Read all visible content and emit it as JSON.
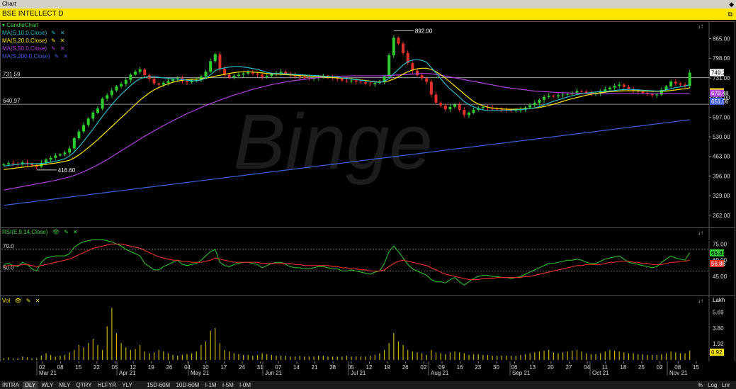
{
  "window": {
    "title": "Chart",
    "symbol": "BSE INTELLECT D"
  },
  "legend": {
    "main": "CandleChart",
    "ma": [
      {
        "label": "MA(S,10.0,Close)",
        "color": "#2bb8c8"
      },
      {
        "label": "MA(S,20.0,Close)",
        "color": "#ffe800"
      },
      {
        "label": "MA(S,50.0,Close)",
        "color": "#b040e0"
      },
      {
        "label": "MA(S,200.0,Close)",
        "color": "#4060e0"
      }
    ],
    "rsi": "RSI(E,9,14,Close)",
    "vol": "Vol",
    "vol_unit": "Lakh"
  },
  "annotations": {
    "high_label": "892.00",
    "low_label": "416.60",
    "hline1": "731.59",
    "hline2": "640.97",
    "rsi_70": "70.0",
    "rsi_50": "50.0"
  },
  "price_axis": {
    "ticks": [
      "865.00",
      "798.00",
      "731.00",
      "664.00",
      "597.00",
      "530.00",
      "463.00",
      "396.00",
      "329.00",
      "262.00"
    ],
    "last_price": "749.20",
    "tag_yellow": "683.46",
    "tag_purple": "678.48",
    "tag_blue": "651.06"
  },
  "rsi_axis": {
    "ticks": [
      "75.00",
      "60.00",
      "45.00"
    ],
    "tag_green": "66.81",
    "tag_red": "56.88"
  },
  "vol_axis": {
    "ticks": [
      "5.69",
      "3.80",
      "1.92"
    ],
    "tag": "0.92"
  },
  "x_axis": {
    "days": [
      "02",
      "08",
      "15",
      "22",
      "05",
      "12",
      "19",
      "26",
      "04",
      "10",
      "17",
      "24",
      "31",
      "07",
      "14",
      "21",
      "28",
      "05",
      "12",
      "19",
      "26",
      "02",
      "09",
      "16",
      "23",
      "30",
      "06",
      "13",
      "20",
      "27",
      "04",
      "11",
      "18",
      "25",
      "02",
      "08",
      "15"
    ],
    "months": [
      "Mar 21",
      "Apr 21",
      "May 21",
      "Jun 21",
      "Jul 21",
      "Aug 21",
      "Sep 21",
      "Oct 21",
      "Nov 21"
    ]
  },
  "bottom_bar": {
    "periods": [
      "INTRA",
      "DLY",
      "WLY",
      "MLY",
      "QTRY",
      "HLFYR",
      "YLY"
    ],
    "intraday": [
      "15D-60M",
      "10D-60M",
      "I-1M",
      "I-5M",
      "I-0M"
    ],
    "active": "DLY",
    "right": [
      "%",
      "Log",
      "Lnr"
    ]
  },
  "watermark": "Binge",
  "chart_data": {
    "type": "candlestick",
    "title": "BSE INTELLECT D",
    "ylim": [
      230,
      905
    ],
    "close": [
      436,
      440,
      438,
      436,
      442,
      437,
      433,
      428,
      440,
      452,
      458,
      466,
      470,
      476,
      490,
      525,
      548,
      570,
      592,
      612,
      626,
      660,
      672,
      688,
      702,
      710,
      724,
      742,
      752,
      760,
      740,
      728,
      712,
      708,
      714,
      720,
      726,
      730,
      720,
      716,
      722,
      724,
      736,
      752,
      788,
      812,
      762,
      742,
      732,
      738,
      742,
      746,
      750,
      746,
      742,
      734,
      738,
      744,
      748,
      752,
      746,
      740,
      736,
      734,
      730,
      728,
      731,
      734,
      736,
      733,
      730,
      728,
      722,
      720,
      722,
      718,
      716,
      712,
      710,
      714,
      716,
      736,
      808,
      868,
      848,
      816,
      782,
      756,
      740,
      730,
      718,
      674,
      646,
      636,
      624,
      632,
      640,
      622,
      604,
      612,
      622,
      628,
      632,
      630,
      626,
      624,
      622,
      620,
      618,
      620,
      624,
      630,
      638,
      646,
      656,
      666,
      670,
      668,
      672,
      674,
      676,
      680,
      686,
      684,
      680,
      676,
      678,
      686,
      692,
      698,
      704,
      708,
      700,
      692,
      688,
      684,
      680,
      676,
      672,
      674,
      690,
      702,
      718,
      712,
      708,
      704,
      749
    ],
    "ma10": [
      430,
      432,
      434,
      436,
      438,
      438,
      438,
      438,
      439,
      441,
      443,
      446,
      450,
      455,
      464,
      478,
      495,
      515,
      535,
      556,
      578,
      600,
      620,
      640,
      658,
      675,
      690,
      705,
      718,
      728,
      733,
      735,
      735,
      733,
      731,
      729,
      728,
      727,
      725,
      723,
      722,
      721,
      724,
      730,
      742,
      756,
      762,
      765,
      768,
      770,
      770,
      768,
      766,
      763,
      760,
      755,
      750,
      747,
      746,
      746,
      745,
      744,
      743,
      742,
      741,
      740,
      739,
      738,
      737,
      736,
      735,
      734,
      731,
      729,
      727,
      725,
      723,
      721,
      719,
      717,
      716,
      719,
      729,
      745,
      760,
      775,
      786,
      792,
      793,
      791,
      784,
      766,
      748,
      728,
      710,
      693,
      679,
      665,
      650,
      640,
      632,
      626,
      622,
      620,
      619,
      619,
      619,
      620,
      621,
      622,
      623,
      624,
      626,
      629,
      633,
      639,
      645,
      651,
      656,
      661,
      666,
      670,
      674,
      677,
      679,
      681,
      683,
      684,
      685,
      686,
      688,
      690,
      691,
      692,
      691,
      690,
      689,
      688,
      687,
      686,
      687,
      690,
      694,
      698,
      700,
      703,
      708
    ],
    "ma20": [
      418,
      420,
      422,
      424,
      426,
      428,
      430,
      432,
      434,
      436,
      438,
      440,
      443,
      446,
      450,
      458,
      468,
      480,
      493,
      506,
      520,
      535,
      550,
      565,
      580,
      595,
      610,
      625,
      640,
      655,
      668,
      680,
      690,
      698,
      705,
      711,
      716,
      720,
      723,
      725,
      726,
      727,
      728,
      730,
      733,
      737,
      740,
      743,
      746,
      749,
      751,
      752,
      752,
      751,
      750,
      748,
      746,
      745,
      744,
      743,
      742,
      741,
      740,
      739,
      738,
      737,
      736,
      735,
      734,
      733,
      732,
      731,
      730,
      729,
      728,
      726,
      724,
      722,
      720,
      718,
      717,
      718,
      721,
      727,
      735,
      744,
      752,
      758,
      762,
      764,
      764,
      760,
      752,
      742,
      730,
      717,
      703,
      690,
      676,
      663,
      650,
      642,
      636,
      631,
      628,
      626,
      625,
      624,
      624,
      624,
      624,
      625,
      626,
      628,
      630,
      633,
      637,
      641,
      646,
      651,
      656,
      660,
      664,
      668,
      672,
      675,
      678,
      680,
      682,
      684,
      685,
      686,
      687,
      687,
      687,
      687,
      686,
      686,
      685,
      685,
      685,
      686,
      688,
      690,
      692,
      694,
      697
    ],
    "ma50": [
      348,
      351,
      354,
      357,
      360,
      363,
      366,
      369,
      372,
      375,
      378,
      381,
      385,
      389,
      393,
      398,
      404,
      411,
      418,
      426,
      434,
      443,
      452,
      462,
      472,
      482,
      492,
      502,
      512,
      522,
      532,
      541,
      550,
      559,
      568,
      577,
      585,
      593,
      601,
      609,
      616,
      623,
      630,
      637,
      643,
      649,
      655,
      661,
      667,
      672,
      677,
      682,
      687,
      692,
      696,
      700,
      704,
      708,
      711,
      714,
      717,
      720,
      722,
      724,
      726,
      728,
      730,
      732,
      733,
      734,
      735,
      736,
      737,
      737,
      738,
      738,
      738,
      738,
      738,
      738,
      738,
      738,
      739,
      740,
      741,
      742,
      743,
      744,
      745,
      746,
      746,
      745,
      743,
      740,
      737,
      734,
      731,
      728,
      725,
      722,
      719,
      716,
      713,
      710,
      707,
      704,
      701,
      698,
      696,
      694,
      692,
      690,
      688,
      686,
      685,
      684,
      683,
      682,
      681,
      680,
      680,
      679,
      679,
      678,
      678,
      678,
      678,
      678,
      678,
      678,
      678,
      678,
      678,
      678,
      678,
      678,
      677,
      677,
      677,
      677,
      678,
      678,
      678,
      678,
      678,
      678,
      678
    ],
    "ma200": [
      296,
      298,
      300,
      302,
      304,
      306,
      308,
      310,
      312,
      314,
      316,
      318,
      320,
      322,
      324,
      326,
      328,
      330,
      332,
      334,
      336,
      338,
      340,
      342,
      344,
      346,
      348,
      350,
      352,
      354,
      356,
      358,
      360,
      362,
      364,
      366,
      368,
      370,
      372,
      374,
      376,
      378,
      380,
      382,
      384,
      386,
      388,
      390,
      392,
      394,
      396,
      398,
      400,
      402,
      404,
      406,
      408,
      410,
      412,
      414,
      416,
      418,
      420,
      422,
      424,
      426,
      428,
      430,
      432,
      434,
      436,
      438,
      440,
      442,
      444,
      446,
      448,
      450,
      452,
      454,
      456,
      458,
      460,
      462,
      464,
      466,
      468,
      470,
      472,
      474,
      476,
      478,
      480,
      482,
      484,
      486,
      488,
      490,
      492,
      494,
      496,
      498,
      500,
      502,
      504,
      506,
      508,
      510,
      512,
      514,
      516,
      518,
      520,
      522,
      524,
      526,
      528,
      530,
      532,
      534,
      536,
      538,
      540,
      542,
      544,
      546,
      548,
      550,
      552,
      554,
      556,
      558,
      560,
      562,
      564,
      566,
      568,
      570,
      572,
      574,
      576,
      578,
      580,
      582,
      584,
      586,
      588
    ],
    "rsi": [
      56,
      57,
      55,
      54,
      58,
      56,
      52,
      50,
      58,
      62,
      63,
      64,
      64,
      64,
      66,
      72,
      75,
      77,
      78,
      79,
      79,
      79,
      78,
      77,
      75,
      73,
      70,
      68,
      66,
      64,
      57,
      54,
      51,
      51,
      54,
      56,
      58,
      60,
      56,
      55,
      56,
      57,
      60,
      64,
      68,
      70,
      58,
      55,
      54,
      56,
      57,
      58,
      58,
      57,
      56,
      53,
      55,
      57,
      58,
      58,
      56,
      54,
      53,
      53,
      52,
      52,
      53,
      54,
      54,
      53,
      52,
      52,
      50,
      50,
      51,
      50,
      49,
      48,
      47,
      49,
      50,
      57,
      68,
      73,
      68,
      62,
      56,
      52,
      50,
      48,
      46,
      42,
      40,
      40,
      39,
      42,
      44,
      40,
      37,
      40,
      43,
      45,
      46,
      46,
      45,
      45,
      44,
      44,
      43,
      44,
      45,
      47,
      49,
      51,
      53,
      55,
      57,
      57,
      58,
      59,
      60,
      60,
      61,
      60,
      58,
      57,
      57,
      59,
      61,
      62,
      63,
      64,
      61,
      58,
      57,
      56,
      55,
      54,
      53,
      54,
      58,
      61,
      64,
      62,
      61,
      60,
      67
    ],
    "rsi_signal": [
      54,
      55,
      55,
      55,
      56,
      56,
      55,
      54,
      55,
      56,
      57,
      58,
      59,
      60,
      61,
      63,
      65,
      67,
      69,
      71,
      72,
      73,
      74,
      75,
      75,
      75,
      74,
      73,
      72,
      71,
      69,
      67,
      65,
      63,
      62,
      61,
      60,
      60,
      59,
      59,
      58,
      58,
      58,
      59,
      60,
      62,
      61,
      60,
      59,
      58,
      58,
      58,
      58,
      58,
      58,
      57,
      57,
      57,
      57,
      57,
      57,
      57,
      56,
      56,
      55,
      55,
      55,
      55,
      55,
      55,
      54,
      54,
      53,
      53,
      52,
      52,
      51,
      51,
      50,
      50,
      50,
      51,
      54,
      57,
      59,
      60,
      59,
      58,
      57,
      56,
      55,
      53,
      51,
      49,
      47,
      46,
      45,
      44,
      43,
      42,
      42,
      42,
      43,
      43,
      43,
      44,
      44,
      44,
      44,
      44,
      44,
      45,
      45,
      46,
      47,
      48,
      49,
      50,
      51,
      52,
      53,
      54,
      55,
      55,
      56,
      56,
      56,
      56,
      57,
      58,
      58,
      59,
      59,
      59,
      58,
      58,
      57,
      57,
      56,
      56,
      56,
      57,
      58,
      58,
      59,
      59,
      60
    ],
    "volume": [
      0.2,
      0.3,
      0.2,
      0.2,
      0.4,
      0.3,
      0.2,
      0.2,
      0.5,
      0.8,
      0.6,
      0.4,
      0.5,
      0.6,
      0.9,
      1.2,
      1.8,
      1.5,
      2.0,
      2.5,
      1.8,
      1.2,
      4.0,
      6.2,
      3.2,
      2.0,
      1.5,
      1.2,
      1.3,
      1.8,
      1.0,
      0.8,
      0.9,
      1.2,
      1.0,
      0.8,
      0.6,
      0.5,
      0.6,
      0.7,
      0.8,
      1.0,
      1.8,
      2.2,
      3.5,
      3.8,
      2.0,
      1.2,
      1.0,
      0.8,
      0.7,
      0.6,
      0.6,
      0.5,
      0.6,
      0.8,
      0.7,
      0.6,
      0.5,
      0.5,
      0.5,
      0.4,
      0.4,
      0.5,
      0.4,
      0.4,
      0.4,
      0.5,
      0.5,
      0.4,
      0.4,
      0.4,
      0.4,
      0.5,
      0.4,
      0.4,
      0.4,
      0.4,
      0.5,
      0.6,
      0.8,
      1.2,
      2.0,
      3.2,
      2.2,
      1.8,
      1.2,
      1.0,
      0.9,
      0.8,
      0.6,
      1.2,
      0.9,
      0.8,
      0.7,
      0.9,
      1.0,
      0.9,
      0.8,
      0.6,
      0.7,
      0.7,
      0.6,
      0.6,
      0.5,
      0.5,
      0.5,
      0.5,
      0.5,
      0.5,
      0.6,
      0.7,
      0.8,
      0.9,
      1.0,
      1.1,
      1.2,
      0.9,
      0.8,
      0.9,
      1.0,
      1.1,
      1.2,
      1.0,
      0.8,
      0.7,
      0.7,
      0.8,
      1.0,
      1.2,
      1.1,
      1.0,
      0.9,
      0.8,
      0.8,
      0.7,
      0.7,
      0.6,
      0.6,
      0.6,
      0.7,
      0.8,
      1.0,
      0.9,
      0.8,
      0.8,
      1.1
    ]
  }
}
